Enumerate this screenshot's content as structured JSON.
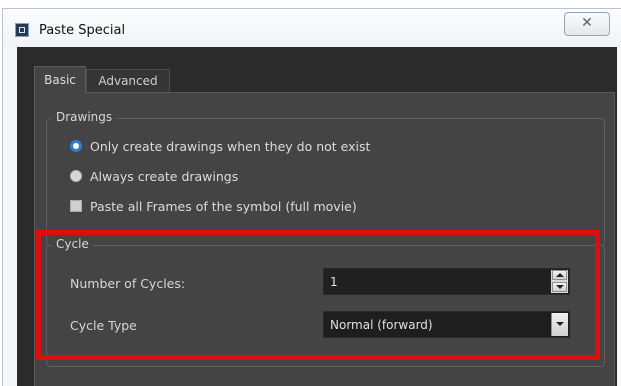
{
  "window": {
    "title": "Paste Special",
    "close_glyph": "✕"
  },
  "tabs": [
    {
      "label": "Basic",
      "active": true
    },
    {
      "label": "Advanced",
      "active": false
    }
  ],
  "drawings": {
    "legend": "Drawings",
    "options": [
      {
        "label": "Only create drawings when they do not exist",
        "type": "radio",
        "checked": true
      },
      {
        "label": "Always create drawings",
        "type": "radio",
        "checked": false
      },
      {
        "label": "Paste all Frames of the symbol (full movie)",
        "type": "checkbox",
        "checked": false
      }
    ]
  },
  "cycle": {
    "legend": "Cycle",
    "number_of_cycles": {
      "label": "Number of Cycles:",
      "value": "1"
    },
    "cycle_type": {
      "label": "Cycle Type",
      "value": "Normal (forward)"
    }
  },
  "colors": {
    "highlight": "#e00d0d",
    "radio_accent": "#2d7fd1",
    "panel_bg": "#444444"
  },
  "icons": {
    "app": "paste-special-icon",
    "close": "close-icon"
  }
}
